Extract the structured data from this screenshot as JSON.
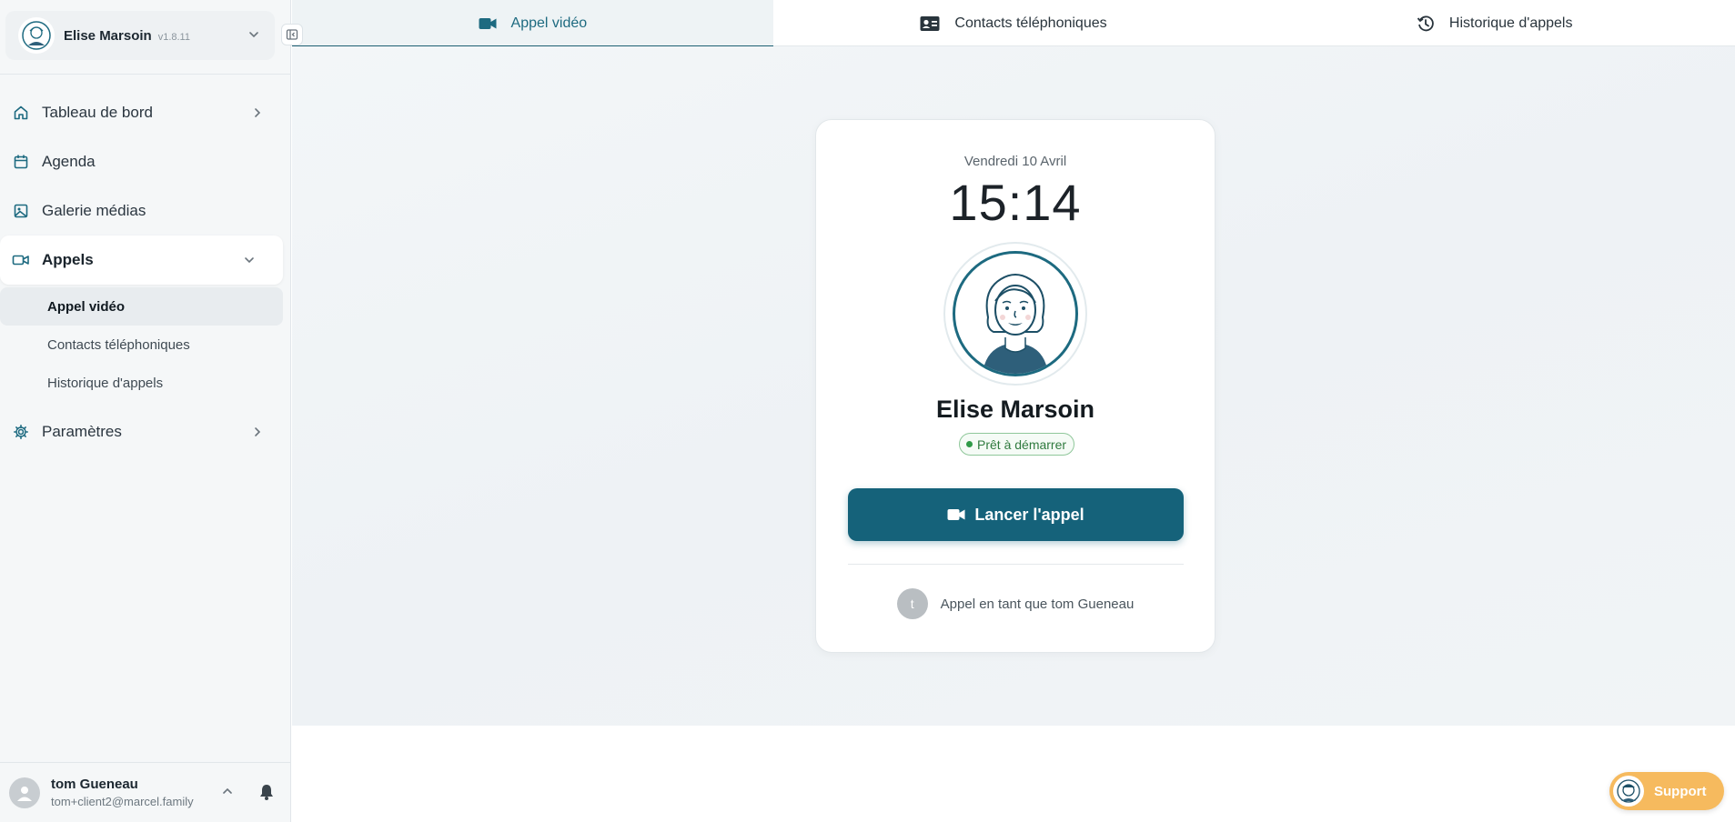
{
  "profile": {
    "name": "Elise Marsoin",
    "version": "v1.8.11"
  },
  "sidebar": {
    "items": [
      {
        "label": "Tableau de bord",
        "icon": "home-icon"
      },
      {
        "label": "Agenda",
        "icon": "calendar-icon"
      },
      {
        "label": "Galerie médias",
        "icon": "image-icon"
      },
      {
        "label": "Appels",
        "icon": "video-icon",
        "expanded": true,
        "children": [
          {
            "label": "Appel vidéo",
            "active": true
          },
          {
            "label": "Contacts téléphoniques"
          },
          {
            "label": "Historique d'appels"
          }
        ]
      },
      {
        "label": "Paramètres",
        "icon": "gear-icon"
      }
    ]
  },
  "user": {
    "name": "tom Gueneau",
    "email": "tom+client2@marcel.family"
  },
  "tabs": [
    {
      "label": "Appel vidéo",
      "icon": "video-camera-icon",
      "active": true
    },
    {
      "label": "Contacts téléphoniques",
      "icon": "contact-card-icon"
    },
    {
      "label": "Historique d'appels",
      "icon": "history-icon"
    }
  ],
  "call_card": {
    "date": "Vendredi 10 Avril",
    "time": "15:14",
    "callee": "Elise Marsoin",
    "status": "Prêt à démarrer",
    "button": "Lancer l'appel",
    "caller_initial": "t",
    "caller_text": "Appel en tant que tom Gueneau"
  },
  "support": {
    "label": "Support"
  },
  "colors": {
    "accent": "#15627a",
    "status_green": "#2f7a3e",
    "support": "#f6ba5e"
  }
}
